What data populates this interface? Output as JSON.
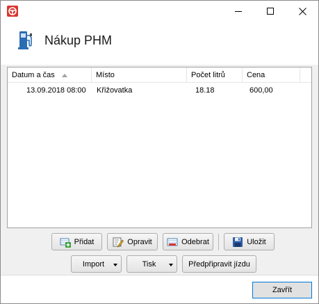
{
  "window": {
    "app_icon": "steering-wheel-icon",
    "controls": [
      "minimize-icon",
      "maximize-icon",
      "close-icon"
    ]
  },
  "header": {
    "icon": "fuel-pump-icon",
    "title": "Nákup PHM"
  },
  "table": {
    "columns": [
      "Datum a čas",
      "Místo",
      "Počet litrů",
      "Cena"
    ],
    "sort_column": "Datum a čas",
    "sort_direction": "ascending",
    "rows": [
      {
        "datetime": "13.09.2018 08:00",
        "place": "Křižovatka",
        "liters": "18.18",
        "price": "600,00"
      }
    ]
  },
  "actions": {
    "add": "Přidat",
    "edit": "Opravit",
    "remove": "Odebrat",
    "save": "Uložit",
    "import": "Import",
    "print": "Tisk",
    "prepare": "Předpřipravit jízdu"
  },
  "footer": {
    "close": "Zavřít"
  },
  "colors": {
    "accent": "#0078d7",
    "app_icon_bg": "#d9372f",
    "pump_icon": "#2a6db3"
  }
}
